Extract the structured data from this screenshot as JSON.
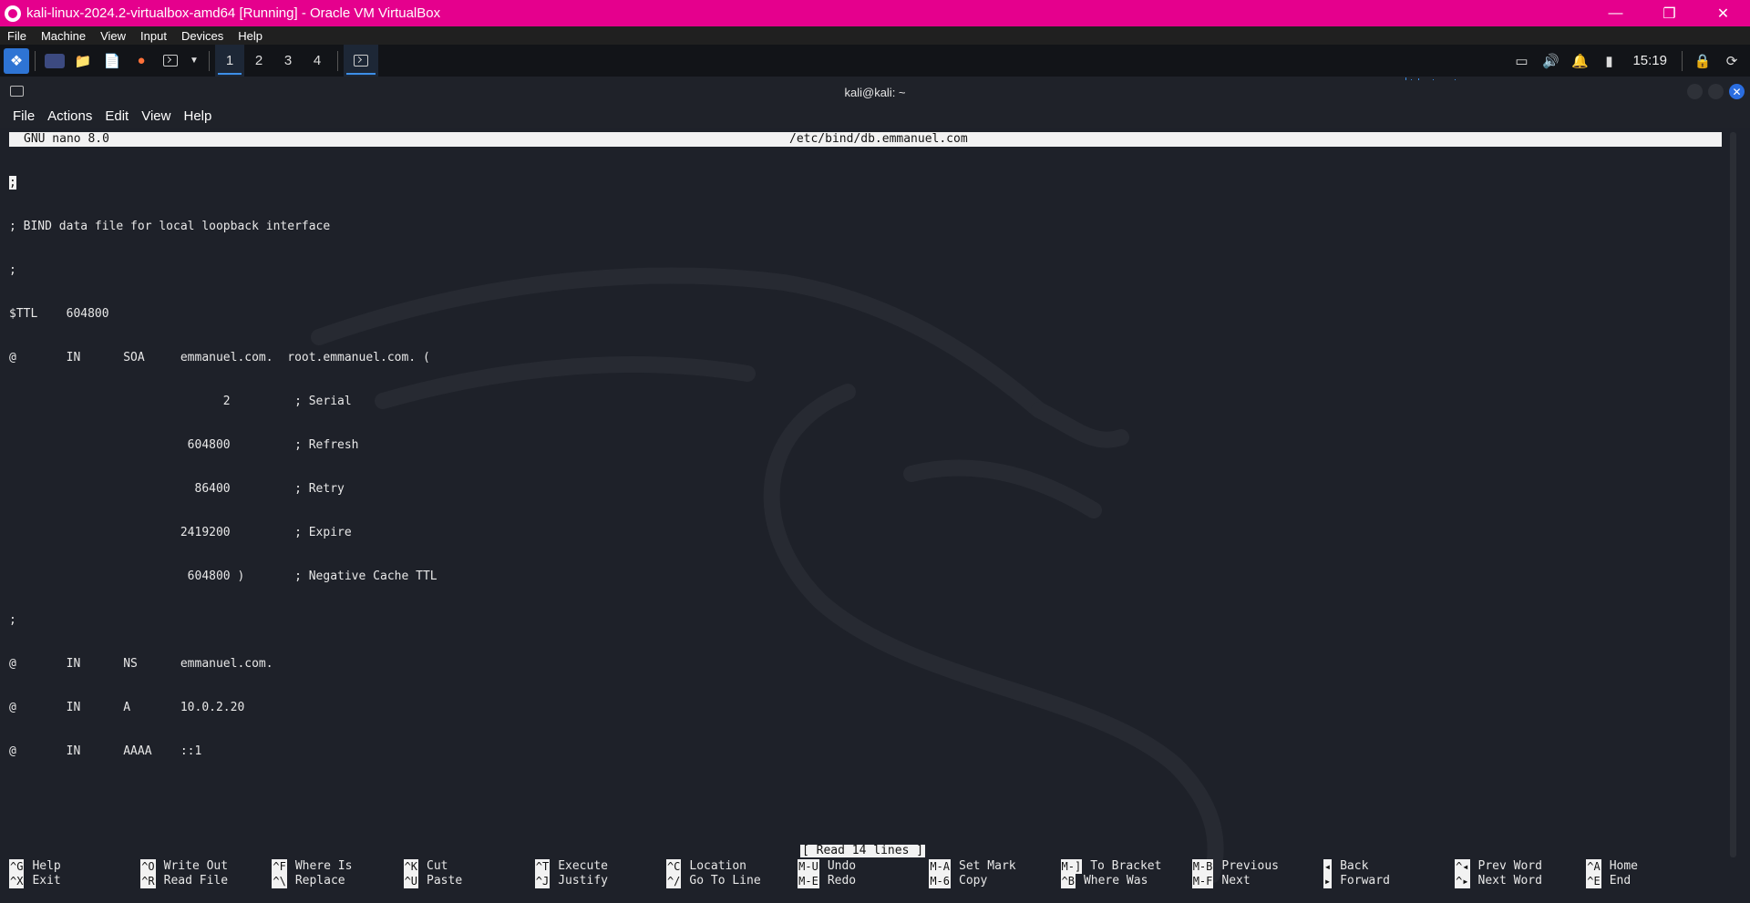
{
  "vbox": {
    "title": "kali-linux-2024.2-virtualbox-amd64 [Running] - Oracle VM VirtualBox",
    "window_controls": [
      "minimize",
      "restore",
      "close"
    ],
    "menu": [
      "File",
      "Machine",
      "View",
      "Input",
      "Devices",
      "Help"
    ]
  },
  "panel": {
    "workspaces": [
      "1",
      "2",
      "3",
      "4"
    ],
    "active_workspace": "1",
    "clock": "15:19"
  },
  "terminal": {
    "title": "kali@kali: ~",
    "menu": [
      "File",
      "Actions",
      "Edit",
      "View",
      "Help"
    ]
  },
  "nano": {
    "version": "GNU nano 8.0",
    "filename": "/etc/bind/db.emmanuel.com",
    "cursor_line": ";",
    "lines": [
      "; BIND data file for local loopback interface",
      ";",
      "$TTL    604800",
      "@       IN      SOA     emmanuel.com.  root.emmanuel.com. (",
      "                              2         ; Serial",
      "                         604800         ; Refresh",
      "                          86400         ; Retry",
      "                        2419200         ; Expire",
      "                         604800 )       ; Negative Cache TTL",
      ";",
      "@       IN      NS      emmanuel.com.",
      "@       IN      A       10.0.2.20",
      "@       IN      AAAA    ::1"
    ],
    "status": "[ Read 14 lines ]",
    "shortcuts_row1": [
      {
        "key": "^G",
        "label": "Help"
      },
      {
        "key": "^O",
        "label": "Write Out"
      },
      {
        "key": "^F",
        "label": "Where Is"
      },
      {
        "key": "^K",
        "label": "Cut"
      },
      {
        "key": "^T",
        "label": "Execute"
      },
      {
        "key": "^C",
        "label": "Location"
      },
      {
        "key": "M-U",
        "label": "Undo"
      },
      {
        "key": "M-A",
        "label": "Set Mark"
      },
      {
        "key": "M-]",
        "label": "To Bracket"
      },
      {
        "key": "M-B",
        "label": "Previous"
      },
      {
        "key": "◂",
        "label": "Back"
      },
      {
        "key": "^◂",
        "label": "Prev Word"
      },
      {
        "key": "^A",
        "label": "Home"
      }
    ],
    "shortcuts_row2": [
      {
        "key": "^X",
        "label": "Exit"
      },
      {
        "key": "^R",
        "label": "Read File"
      },
      {
        "key": "^\\",
        "label": "Replace"
      },
      {
        "key": "^U",
        "label": "Paste"
      },
      {
        "key": "^J",
        "label": "Justify"
      },
      {
        "key": "^/",
        "label": "Go To Line"
      },
      {
        "key": "M-E",
        "label": "Redo"
      },
      {
        "key": "M-6",
        "label": "Copy"
      },
      {
        "key": "^B",
        "label": "Where Was"
      },
      {
        "key": "M-F",
        "label": "Next"
      },
      {
        "key": "▸",
        "label": "Forward"
      },
      {
        "key": "^▸",
        "label": "Next Word"
      },
      {
        "key": "^E",
        "label": "End"
      }
    ]
  }
}
